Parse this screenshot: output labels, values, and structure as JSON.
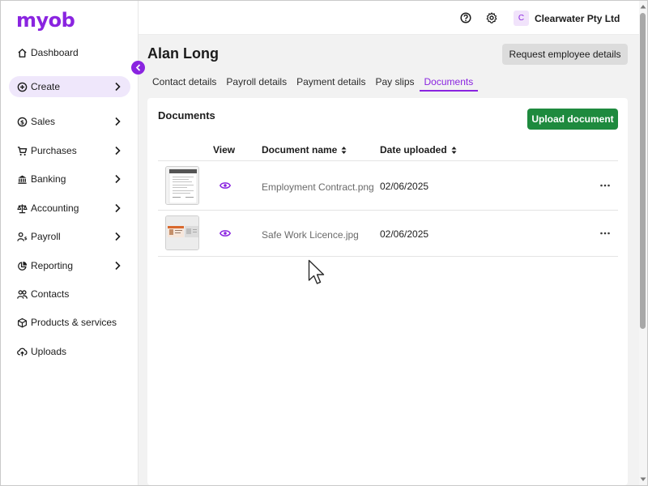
{
  "brand": {
    "logo_text": "myob",
    "accent": "#8a24e0",
    "primary_button": "#1e8a3e"
  },
  "sidebar": {
    "items": [
      {
        "label": "Dashboard",
        "icon": "home-icon",
        "has_chevron": false,
        "active": false
      },
      {
        "label": "Create",
        "icon": "plus-circle-icon",
        "has_chevron": true,
        "active": true
      },
      {
        "label": "Sales",
        "icon": "dollar-circle-icon",
        "has_chevron": true,
        "active": false
      },
      {
        "label": "Purchases",
        "icon": "cart-icon",
        "has_chevron": true,
        "active": false
      },
      {
        "label": "Banking",
        "icon": "bank-icon",
        "has_chevron": true,
        "active": false
      },
      {
        "label": "Accounting",
        "icon": "scales-icon",
        "has_chevron": true,
        "active": false
      },
      {
        "label": "Payroll",
        "icon": "person-dollar-icon",
        "has_chevron": true,
        "active": false
      },
      {
        "label": "Reporting",
        "icon": "pie-chart-icon",
        "has_chevron": true,
        "active": false
      },
      {
        "label": "Contacts",
        "icon": "people-icon",
        "has_chevron": false,
        "active": false
      },
      {
        "label": "Products & services",
        "icon": "box-icon",
        "has_chevron": false,
        "active": false
      },
      {
        "label": "Uploads",
        "icon": "cloud-upload-icon",
        "has_chevron": false,
        "active": false
      }
    ]
  },
  "topbar": {
    "help_icon": "help-circle-icon",
    "settings_icon": "gear-icon",
    "org_initial": "C",
    "org_name": "Clearwater Pty Ltd"
  },
  "page": {
    "title": "Alan Long",
    "request_button": "Request employee details",
    "tabs": [
      {
        "label": "Contact details",
        "active": false
      },
      {
        "label": "Payroll details",
        "active": false
      },
      {
        "label": "Payment details",
        "active": false
      },
      {
        "label": "Pay slips",
        "active": false
      },
      {
        "label": "Documents",
        "active": true
      }
    ]
  },
  "documents": {
    "title": "Documents",
    "upload_button": "Upload document",
    "columns": {
      "view": "View",
      "name": "Document name",
      "date": "Date uploaded"
    },
    "rows": [
      {
        "name": "Employment Contract.png",
        "date": "02/06/2025",
        "thumbnail": "contract-thumbnail"
      },
      {
        "name": "Safe Work Licence.jpg",
        "date": "02/06/2025",
        "thumbnail": "licence-thumbnail"
      }
    ]
  }
}
